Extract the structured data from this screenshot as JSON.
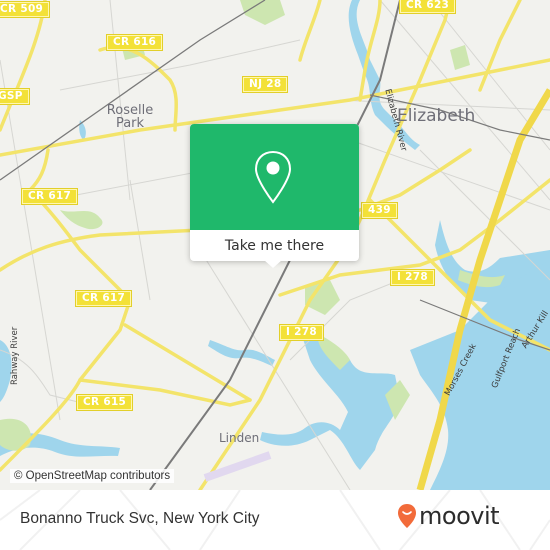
{
  "map": {
    "background_color": "#f2f2ee",
    "road_color": "#f3e46a",
    "water_color": "#9fd5ec",
    "park_color": "#cde6b0",
    "places": [
      {
        "id": "roselle-park",
        "label": "Roselle Park"
      },
      {
        "id": "elizabeth",
        "label": "Elizabeth"
      },
      {
        "id": "linden",
        "label": "Linden"
      }
    ],
    "road_shields": [
      {
        "id": "cr-509",
        "label": "CR 509"
      },
      {
        "id": "cr-623",
        "label": "CR 623"
      },
      {
        "id": "cr-616",
        "label": "CR 616"
      },
      {
        "id": "gsp",
        "label": "GSP"
      },
      {
        "id": "nj-28",
        "label": "NJ 28"
      },
      {
        "id": "cr-617-a",
        "label": "CR 617"
      },
      {
        "id": "cr-617-b",
        "label": "CR 617"
      },
      {
        "id": "nj-439",
        "label": "439"
      },
      {
        "id": "i-278-a",
        "label": "I 278"
      },
      {
        "id": "i-278-b",
        "label": "I 278"
      },
      {
        "id": "cr-615",
        "label": "CR 615"
      }
    ],
    "water_labels": [
      {
        "id": "elizabeth-river",
        "label": "Elizabeth River"
      },
      {
        "id": "rahway-river",
        "label": "Rahway River"
      },
      {
        "id": "morses-creek",
        "label": "Morses Creek"
      },
      {
        "id": "gulfport-reach",
        "label": "Gulfport Reach"
      },
      {
        "id": "arthur-kill",
        "label": "Arthur Kill"
      }
    ],
    "attribution": "© OpenStreetMap contributors"
  },
  "popup": {
    "icon": "map-pin-icon",
    "button_label": "Take me there",
    "accent_color": "#1fb86b"
  },
  "footer": {
    "place_title": "Bonanno Truck Svc, New York City",
    "logo_text": "moovit",
    "logo_icon": "moovit-pin-smile-icon",
    "logo_color": "#f26b3a"
  }
}
